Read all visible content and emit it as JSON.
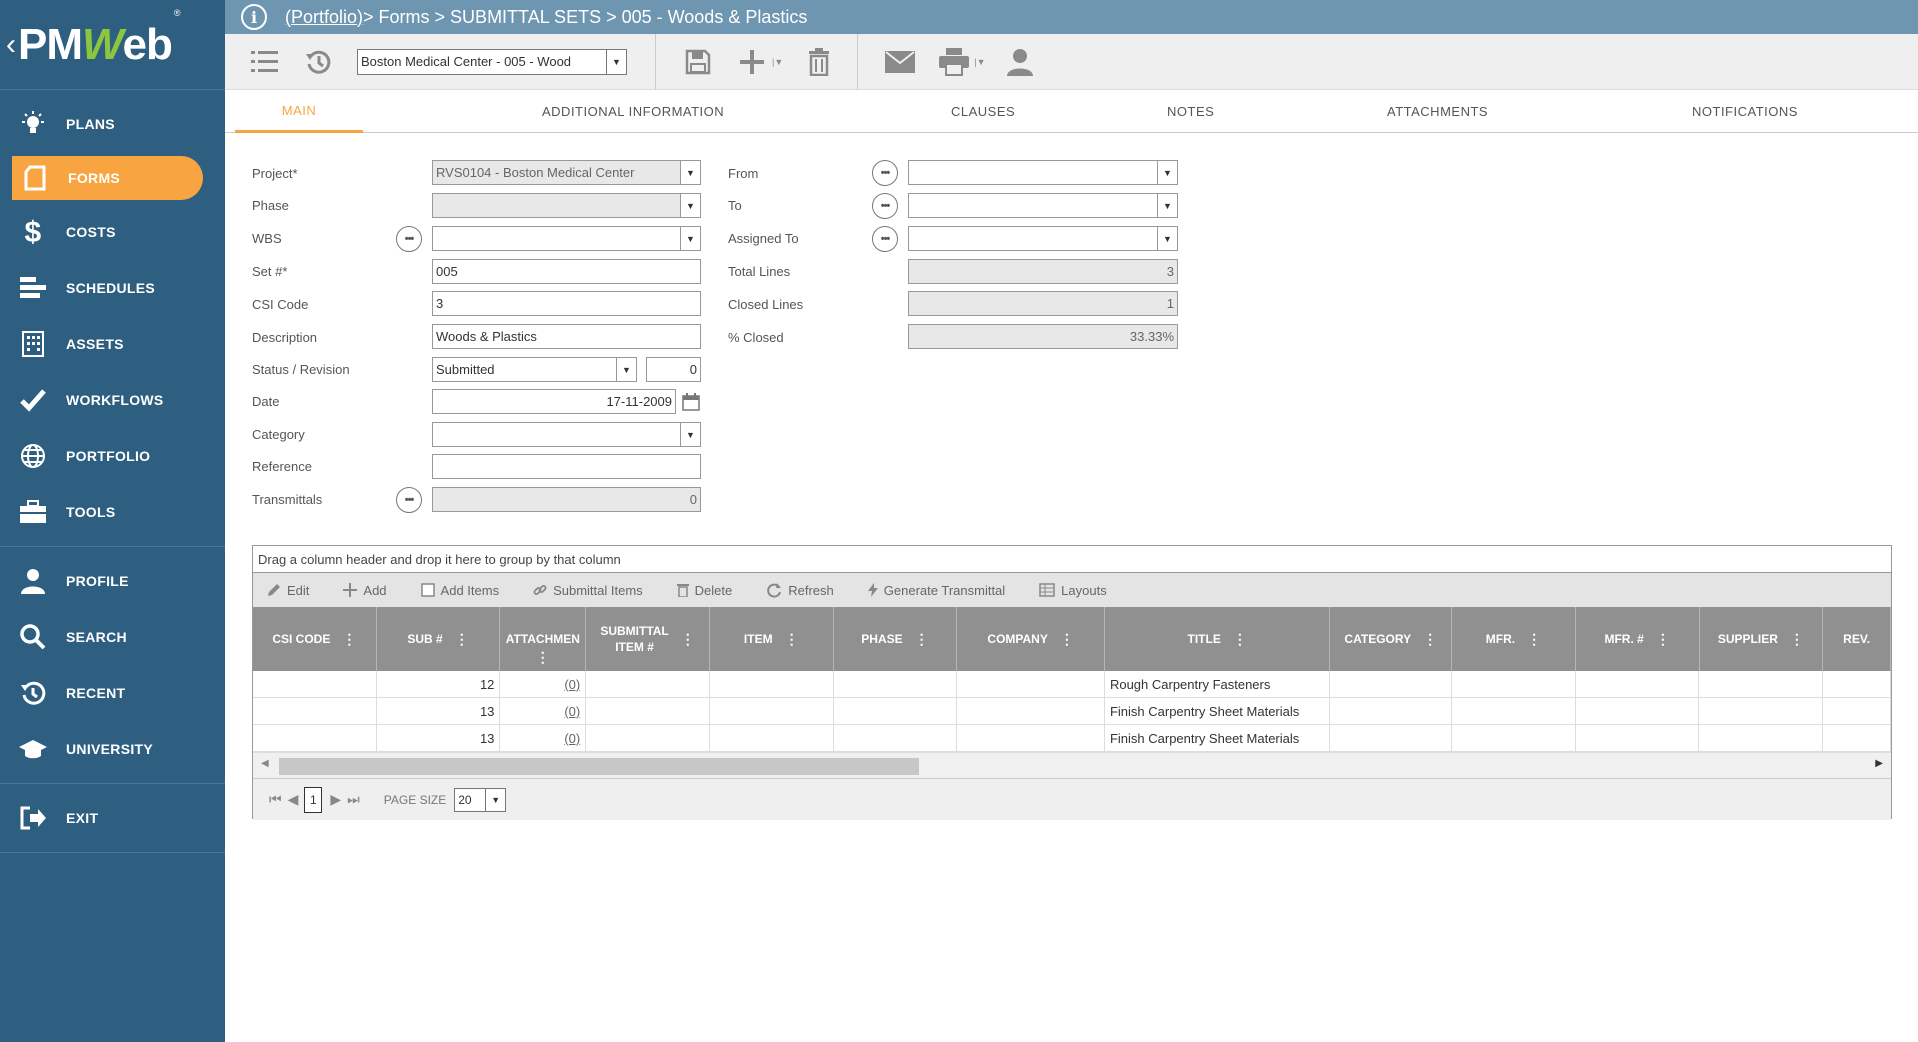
{
  "logo": {
    "text_a": "PM",
    "text_w": "W",
    "text_b": "eb",
    "reg": "®"
  },
  "sidebar": {
    "groups": [
      [
        {
          "label": "PLANS",
          "icon": "bulb-icon"
        },
        {
          "label": "FORMS",
          "icon": "document-icon",
          "active": true
        },
        {
          "label": "COSTS",
          "icon": "dollar-icon"
        },
        {
          "label": "SCHEDULES",
          "icon": "gantt-icon"
        },
        {
          "label": "ASSETS",
          "icon": "building-icon"
        },
        {
          "label": "WORKFLOWS",
          "icon": "checkmark-icon"
        },
        {
          "label": "PORTFOLIO",
          "icon": "globe-icon"
        },
        {
          "label": "TOOLS",
          "icon": "toolbox-icon"
        }
      ],
      [
        {
          "label": "PROFILE",
          "icon": "user-icon"
        },
        {
          "label": "SEARCH",
          "icon": "search-icon"
        },
        {
          "label": "RECENT",
          "icon": "history-icon"
        },
        {
          "label": "UNIVERSITY",
          "icon": "graduation-cap-icon"
        }
      ],
      [
        {
          "label": "EXIT",
          "icon": "exit-icon"
        }
      ]
    ]
  },
  "breadcrumb": {
    "link": "(Portfolio)",
    "rest": " > Forms > SUBMITTAL SETS > 005 - Woods & Plastics"
  },
  "toolbar": {
    "record_select": "Boston Medical Center - 005 - Wood"
  },
  "tabs": [
    {
      "label": "MAIN",
      "active": true
    },
    {
      "label": "ADDITIONAL INFORMATION"
    },
    {
      "label": "CLAUSES"
    },
    {
      "label": "NOTES"
    },
    {
      "label": "ATTACHMENTS"
    },
    {
      "label": "NOTIFICATIONS"
    }
  ],
  "form": {
    "project_label": "Project*",
    "project_value": "RVS0104 - Boston Medical Center",
    "phase_label": "Phase",
    "phase_value": "",
    "wbs_label": "WBS",
    "wbs_value": "",
    "set_label": "Set #*",
    "set_value": "005",
    "csi_label": "CSI Code",
    "csi_value": "3",
    "description_label": "Description",
    "description_value": "Woods & Plastics",
    "status_label": "Status / Revision",
    "status_value": "Submitted",
    "revision_value": "0",
    "date_label": "Date",
    "date_value": "17-11-2009",
    "category_label": "Category",
    "category_value": "",
    "reference_label": "Reference",
    "reference_value": "",
    "transmittals_label": "Transmittals",
    "transmittals_value": "0",
    "from_label": "From",
    "from_value": "",
    "to_label": "To",
    "to_value": "",
    "assigned_label": "Assigned To",
    "assigned_value": "",
    "total_lines_label": "Total Lines",
    "total_lines_value": "3",
    "closed_lines_label": "Closed Lines",
    "closed_lines_value": "1",
    "pct_closed_label": "% Closed",
    "pct_closed_value": "33.33%"
  },
  "grid": {
    "group_hint": "Drag a column header and drop it here to group by that column",
    "toolbar": [
      {
        "label": "Edit",
        "icon": "pencil-icon"
      },
      {
        "label": "Add",
        "icon": "plus-icon"
      },
      {
        "label": "Add Items",
        "icon": "checkbox-icon"
      },
      {
        "label": "Submittal Items",
        "icon": "link-icon"
      },
      {
        "label": "Delete",
        "icon": "trash-icon"
      },
      {
        "label": "Refresh",
        "icon": "refresh-icon"
      },
      {
        "label": "Generate Transmittal",
        "icon": "bolt-icon"
      },
      {
        "label": "Layouts",
        "icon": "table-icon"
      }
    ],
    "columns": [
      "CSI CODE",
      "SUB #",
      "ATTACHMENTS",
      "SUBMITTAL ITEM #",
      "ITEM",
      "PHASE",
      "COMPANY",
      "TITLE",
      "CATEGORY",
      "MFR.",
      "MFR. #",
      "SUPPLIER",
      "REV."
    ],
    "column_display": [
      "CSI CODE",
      "SUB #",
      "ATTACHMEN",
      "SUBMITTAL\nITEM #",
      "ITEM",
      "PHASE",
      "COMPANY",
      "TITLE",
      "CATEGORY",
      "MFR.",
      "MFR. #",
      "SUPPLIER",
      "REV."
    ],
    "rows": [
      [
        "",
        "12",
        "(0)",
        "",
        "",
        "",
        "",
        "Rough Carpentry Fasteners",
        "",
        "",
        "",
        "",
        ""
      ],
      [
        "",
        "13",
        "(0)",
        "",
        "",
        "",
        "",
        "Finish Carpentry Sheet Materials",
        "",
        "",
        "",
        "",
        ""
      ],
      [
        "",
        "13",
        "(0)",
        "",
        "",
        "",
        "",
        "Finish Carpentry Sheet Materials",
        "",
        "",
        "",
        "",
        ""
      ]
    ],
    "pager": {
      "page": "1",
      "page_size_label": "PAGE SIZE",
      "page_size": "20"
    }
  }
}
